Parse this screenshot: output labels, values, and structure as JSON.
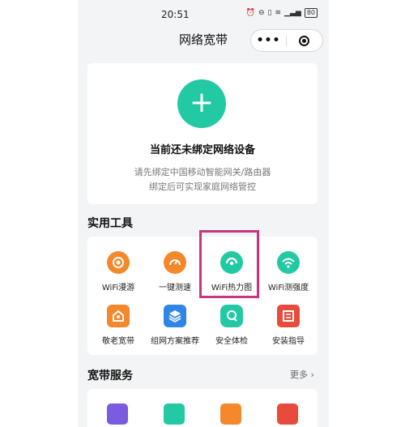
{
  "status_bar": {
    "time": "20:51",
    "battery": "80"
  },
  "nav": {
    "title": "网络宽带",
    "more": "•••"
  },
  "bind_card": {
    "title": "当前还未绑定网络设备",
    "desc_line1": "请先绑定中国移动智能网关/路由器",
    "desc_line2": "绑定后可实现家庭网络管控"
  },
  "tools": {
    "section_title": "实用工具",
    "items": [
      {
        "label": "WiFi漫游",
        "icon": "wifi-roam-icon",
        "color": "#f5882a"
      },
      {
        "label": "一键测速",
        "icon": "speedometer-icon",
        "color": "#f5882a"
      },
      {
        "label": "WiFi热力图",
        "icon": "wifi-heatmap-icon",
        "color": "#23c9a3"
      },
      {
        "label": "WiFi测强度",
        "icon": "wifi-strength-icon",
        "color": "#23c9a3"
      },
      {
        "label": "敬老宽带",
        "icon": "home-elder-icon",
        "color": "#f5882a"
      },
      {
        "label": "组网方案推荐",
        "icon": "layers-icon",
        "color": "#2f86e6"
      },
      {
        "label": "安全体检",
        "icon": "shield-check-icon",
        "color": "#23c9a3"
      },
      {
        "label": "安装指导",
        "icon": "book-icon",
        "color": "#e84a3c"
      }
    ]
  },
  "services": {
    "section_title": "宽带服务",
    "more_label": "更多",
    "icons": [
      "router-icon",
      "home-wifi-icon",
      "tv-box-icon",
      "repair-icon"
    ]
  }
}
